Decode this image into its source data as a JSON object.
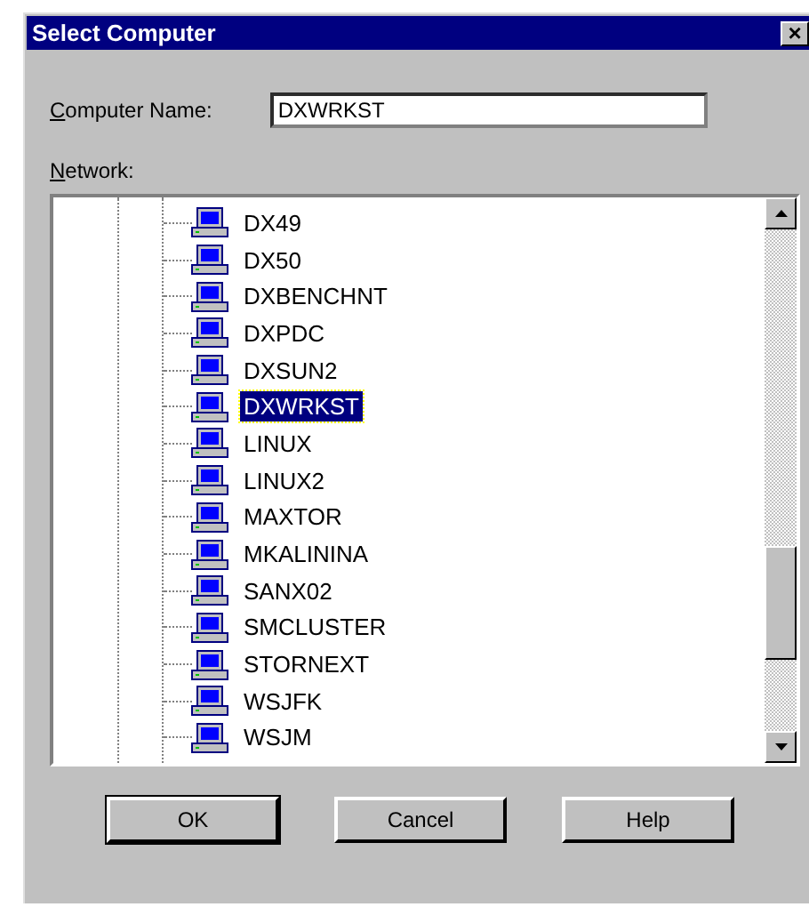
{
  "window": {
    "title": "Select Computer",
    "close": "×"
  },
  "computer_name": {
    "label": "Computer Name:",
    "value": "DXWRKST"
  },
  "network": {
    "label": "Network:",
    "items": [
      {
        "label": "DX49",
        "selected": false
      },
      {
        "label": "DX50",
        "selected": false
      },
      {
        "label": "DXBENCHNT",
        "selected": false
      },
      {
        "label": "DXPDC",
        "selected": false
      },
      {
        "label": "DXSUN2",
        "selected": false
      },
      {
        "label": "DXWRKST",
        "selected": true
      },
      {
        "label": "LINUX",
        "selected": false
      },
      {
        "label": "LINUX2",
        "selected": false
      },
      {
        "label": "MAXTOR",
        "selected": false
      },
      {
        "label": "MKALININA",
        "selected": false
      },
      {
        "label": "SANX02",
        "selected": false
      },
      {
        "label": "SMCLUSTER",
        "selected": false
      },
      {
        "label": "STORNEXT",
        "selected": false
      },
      {
        "label": "WSJFK",
        "selected": false
      },
      {
        "label": "WSJM",
        "selected": false
      }
    ]
  },
  "buttons": [
    "OK",
    "Cancel",
    "Help"
  ]
}
